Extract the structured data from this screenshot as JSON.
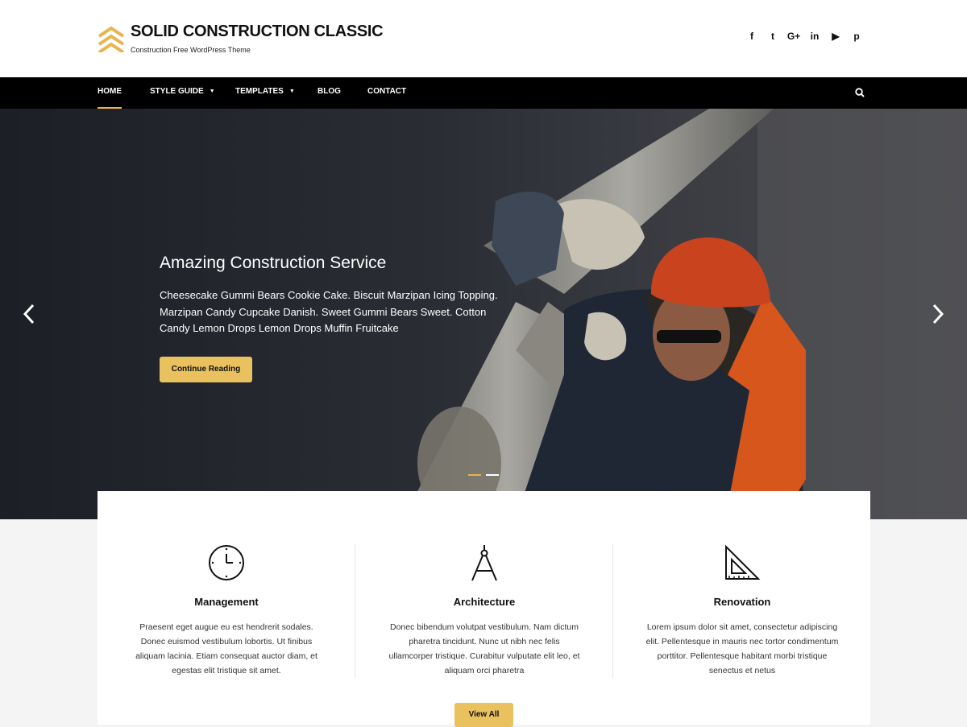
{
  "header": {
    "site_title": "SOLID CONSTRUCTION CLASSIC",
    "tagline": "Construction Free WordPress Theme",
    "social": [
      {
        "icon": "facebook-icon",
        "glyph": "f"
      },
      {
        "icon": "twitter-icon",
        "glyph": "t"
      },
      {
        "icon": "google-plus-icon",
        "glyph": "G+"
      },
      {
        "icon": "linkedin-icon",
        "glyph": "in"
      },
      {
        "icon": "youtube-icon",
        "glyph": "▶"
      },
      {
        "icon": "pinterest-icon",
        "glyph": "p"
      }
    ]
  },
  "nav": {
    "items": [
      {
        "label": "HOME",
        "active": true
      },
      {
        "label": "STYLE GUIDE",
        "has_dropdown": true
      },
      {
        "label": "TEMPLATES",
        "has_dropdown": true
      },
      {
        "label": "BLOG"
      },
      {
        "label": "CONTACT"
      }
    ],
    "search_icon": "search-icon"
  },
  "hero": {
    "title": "Amazing Construction Service",
    "text": "Cheesecake Gummi Bears Cookie Cake. Biscuit Marzipan Icing Topping. Marzipan Candy Cupcake Danish. Sweet Gummi Bears Sweet. Cotton Candy Lemon Drops Lemon Drops Muffin Fruitcake",
    "button": "Continue Reading",
    "slides": 2,
    "active_slide": 1
  },
  "features": [
    {
      "icon": "clock-icon",
      "title": "Management",
      "text": "Praesent eget augue eu est hendrerit sodales. Donec euismod vestibulum lobortis. Ut finibus aliquam lacinia. Etiam consequat auctor diam, et egestas elit tristique sit amet."
    },
    {
      "icon": "compass-icon",
      "title": "Architecture",
      "text": "Donec bibendum volutpat vestibulum. Nam dictum pharetra tincidunt. Nunc ut nibh nec felis ullamcorper tristique. Curabitur vulputate elit leo, et aliquam orci pharetra"
    },
    {
      "icon": "set-square-icon",
      "title": "Renovation",
      "text": "Lorem ipsum dolor sit amet, consectetur adipiscing elit. Pellentesque in mauris nec tortor condimentum porttitor. Pellentesque habitant morbi tristique senectus et netus"
    }
  ],
  "view_all": "View All",
  "colors": {
    "accent": "#e9c15e",
    "nav_bg": "#000000",
    "text": "#111111"
  }
}
